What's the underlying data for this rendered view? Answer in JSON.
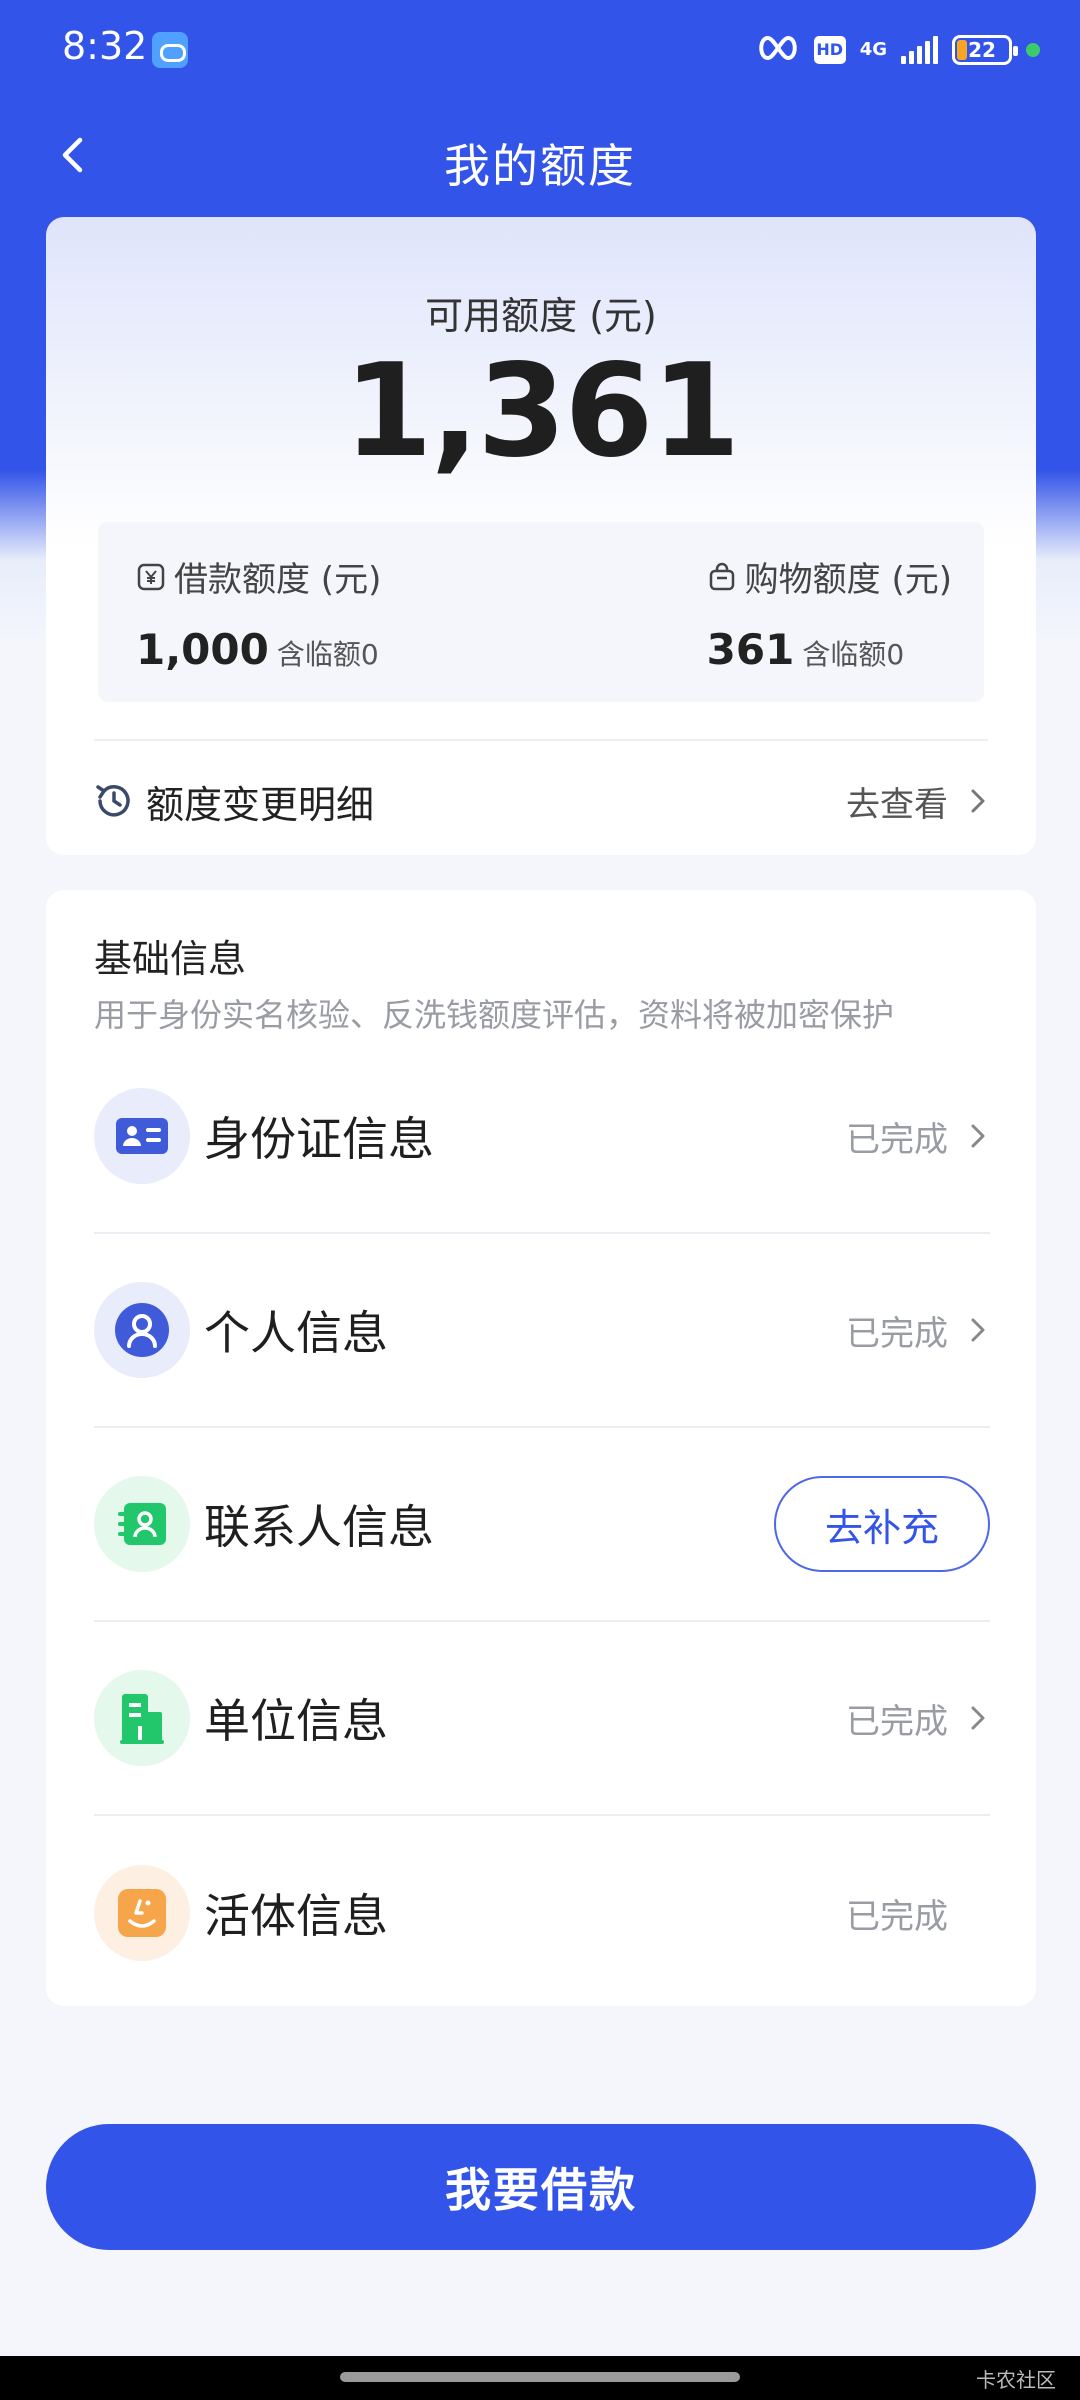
{
  "status_bar": {
    "time": "8:32",
    "hd": "HD",
    "network": "4G",
    "battery": "22"
  },
  "nav": {
    "title": "我的额度"
  },
  "limit": {
    "label": "可用额度 (元)",
    "amount": "1,361",
    "loan": {
      "label": "借款额度 (元)",
      "value": "1,000",
      "note": "含临额0"
    },
    "shopping": {
      "label": "购物额度 (元)",
      "value": "361",
      "note": "含临额0"
    },
    "history": {
      "label": "额度变更明细",
      "link": "去查看"
    }
  },
  "basic_info": {
    "title": "基础信息",
    "subtitle": "用于身份实名核验、反洗钱额度评估，资料将被加密保护",
    "items": [
      {
        "label": "身份证信息",
        "status": "已完成",
        "icon": "id-card-icon",
        "icon_color": "#3f5bd9",
        "icon_bg": "#e8ecfb"
      },
      {
        "label": "个人信息",
        "status": "已完成",
        "icon": "person-icon",
        "icon_color": "#3f5bd9",
        "icon_bg": "#e8ecfb"
      },
      {
        "label": "联系人信息",
        "action": "去补充",
        "icon": "contact-icon",
        "icon_color": "#21c76a",
        "icon_bg": "#e4f8ec"
      },
      {
        "label": "单位信息",
        "status": "已完成",
        "icon": "building-icon",
        "icon_color": "#21c76a",
        "icon_bg": "#e4f8ec"
      },
      {
        "label": "活体信息",
        "status": "已完成",
        "icon": "face-icon",
        "icon_color": "#f7a54a",
        "icon_bg": "#fdf0e2"
      }
    ]
  },
  "main_button": {
    "label": "我要借款"
  },
  "watermark": "卡农社区",
  "colors": {
    "primary": "#3354e8",
    "green": "#21c76a",
    "orange": "#f7a54a"
  }
}
